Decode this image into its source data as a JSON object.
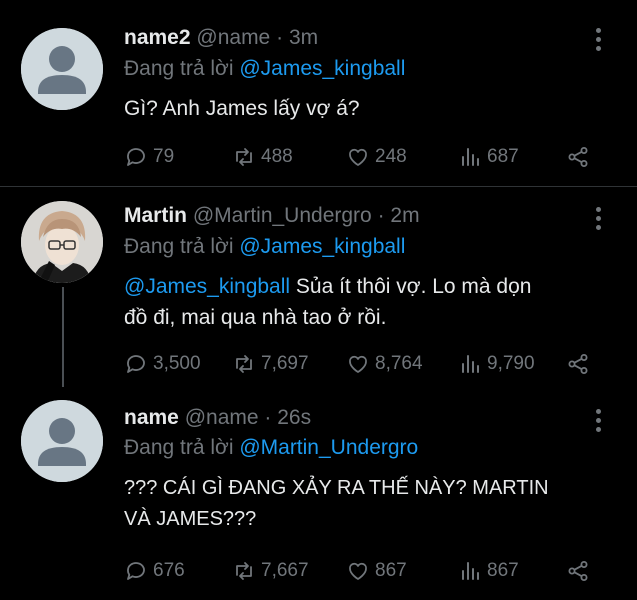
{
  "tweets": [
    {
      "name": "name2",
      "handle": "@name",
      "time": "3m",
      "reply_prefix": "Đang trả lời",
      "reply_to": "@James_kingball",
      "text_mention": "",
      "text_line1": "Gì? Anh James lấy vợ á?",
      "text_line2": "",
      "replies": "79",
      "retweets": "488",
      "likes": "248",
      "views": "687"
    },
    {
      "name": "Martin",
      "handle": "@Martin_Undergro",
      "time": "2m",
      "reply_prefix": "Đang trả lời",
      "reply_to": "@James_kingball",
      "text_mention": "@James_kingball",
      "text_line1": " Sủa ít thôi vợ. Lo mà dọn",
      "text_line2": "đồ đi, mai qua nhà tao ở rồi.",
      "replies": "3,500",
      "retweets": "7,697",
      "likes": "8,764",
      "views": "9,790"
    },
    {
      "name": "name",
      "handle": "@name",
      "time": "26s",
      "reply_prefix": "Đang trả lời",
      "reply_to": "@Martin_Undergro",
      "text_mention": "",
      "text_line1": "??? CÁI GÌ ĐANG XẢY RA THẾ NÀY? MARTIN",
      "text_line2": "VÀ JAMES???",
      "replies": "676",
      "retweets": "7,667",
      "likes": "867",
      "views": "867"
    }
  ],
  "separator": "·",
  "icons": {
    "reply": "reply-icon",
    "retweet": "retweet-icon",
    "like": "heart-icon",
    "views": "views-icon",
    "share": "share-icon",
    "more": "more-vertical-icon"
  },
  "colors": {
    "background": "#000000",
    "text": "#e7e9ea",
    "muted": "#71767b",
    "link": "#1d9bf0"
  }
}
